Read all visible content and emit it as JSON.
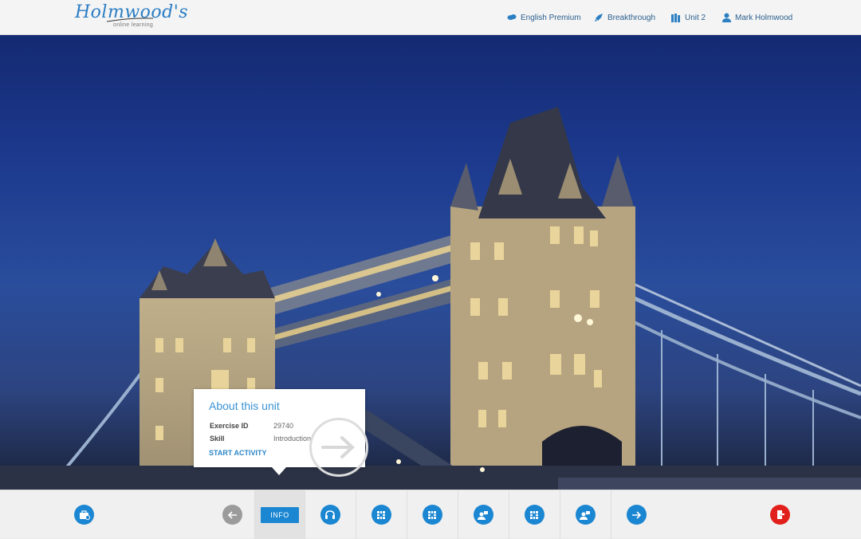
{
  "header": {
    "logo_text": "Holmwood's",
    "logo_subtext": "online learning",
    "nav": [
      {
        "label": "English Premium",
        "icon": "globe-icon"
      },
      {
        "label": "Breakthrough",
        "icon": "rocket-icon"
      },
      {
        "label": "Unit 2",
        "icon": "books-icon"
      },
      {
        "label": "Mark Holmwood",
        "icon": "user-icon"
      }
    ]
  },
  "popup": {
    "title": "About this unit",
    "rows": [
      {
        "label": "Exercise ID",
        "value": "29740"
      },
      {
        "label": "Skill",
        "value": "Introduction"
      }
    ],
    "action": "START ACTIVITY"
  },
  "bottom_bar": {
    "info_label": "INFO",
    "items": [
      {
        "icon": "toolbox-icon"
      },
      {
        "icon": "back-arrow-icon"
      },
      {
        "icon": "info-tab"
      },
      {
        "icon": "headphones-icon"
      },
      {
        "icon": "grid-icon"
      },
      {
        "icon": "grid-icon"
      },
      {
        "icon": "speaking-icon"
      },
      {
        "icon": "grid-icon"
      },
      {
        "icon": "speaking-icon"
      },
      {
        "icon": "next-arrow-icon"
      },
      {
        "icon": "exit-icon"
      }
    ]
  },
  "colors": {
    "accent": "#1b86d1",
    "exit": "#e2201b",
    "header_bg": "#f4f4f4"
  }
}
